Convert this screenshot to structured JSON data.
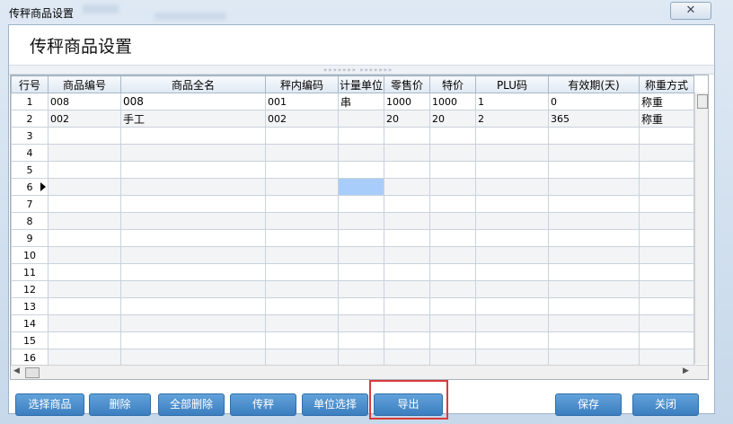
{
  "window": {
    "title": "传秤商品设置",
    "close_icon": "✕"
  },
  "panel": {
    "heading": "传秤商品设置",
    "splitter_grip": "»»»»»»»  »»»»»»»"
  },
  "grid": {
    "columns": [
      "行号",
      "商品编号",
      "商品全名",
      "秤内编码",
      "计量单位",
      "零售价",
      "特价",
      "PLU码",
      "有效期(天)",
      "称重方式"
    ],
    "rows": [
      [
        "1",
        "008",
        "008",
        "001",
        "串",
        "1000",
        "1000",
        "1",
        "0",
        "称重"
      ],
      [
        "2",
        "002",
        "手工",
        "002",
        "",
        "20",
        "20",
        "2",
        "365",
        "称重"
      ],
      [
        "3",
        "",
        "",
        "",
        "",
        "",
        "",
        "",
        "",
        ""
      ],
      [
        "4",
        "",
        "",
        "",
        "",
        "",
        "",
        "",
        "",
        ""
      ],
      [
        "5",
        "",
        "",
        "",
        "",
        "",
        "",
        "",
        "",
        ""
      ],
      [
        "6",
        "",
        "",
        "",
        "",
        "",
        "",
        "",
        "",
        ""
      ],
      [
        "7",
        "",
        "",
        "",
        "",
        "",
        "",
        "",
        "",
        ""
      ],
      [
        "8",
        "",
        "",
        "",
        "",
        "",
        "",
        "",
        "",
        ""
      ],
      [
        "9",
        "",
        "",
        "",
        "",
        "",
        "",
        "",
        "",
        ""
      ],
      [
        "10",
        "",
        "",
        "",
        "",
        "",
        "",
        "",
        "",
        ""
      ],
      [
        "11",
        "",
        "",
        "",
        "",
        "",
        "",
        "",
        "",
        ""
      ],
      [
        "12",
        "",
        "",
        "",
        "",
        "",
        "",
        "",
        "",
        ""
      ],
      [
        "13",
        "",
        "",
        "",
        "",
        "",
        "",
        "",
        "",
        ""
      ],
      [
        "14",
        "",
        "",
        "",
        "",
        "",
        "",
        "",
        "",
        ""
      ],
      [
        "15",
        "",
        "",
        "",
        "",
        "",
        "",
        "",
        "",
        ""
      ],
      [
        "16",
        "",
        "",
        "",
        "",
        "",
        "",
        "",
        "",
        ""
      ]
    ],
    "current_row": "6",
    "selected_cell": "row 6, 计量单位"
  },
  "buttons": {
    "select_goods": "选择商品",
    "delete": "删除",
    "delete_all": "全部删除",
    "send_to_scale": "传秤",
    "unit_select": "单位选择",
    "export": "导出",
    "save": "保存",
    "close": "关闭"
  },
  "colors": {
    "button": "#4a8fcf",
    "selection": "#a9cdfa",
    "highlight_box": "#d93a3a"
  }
}
